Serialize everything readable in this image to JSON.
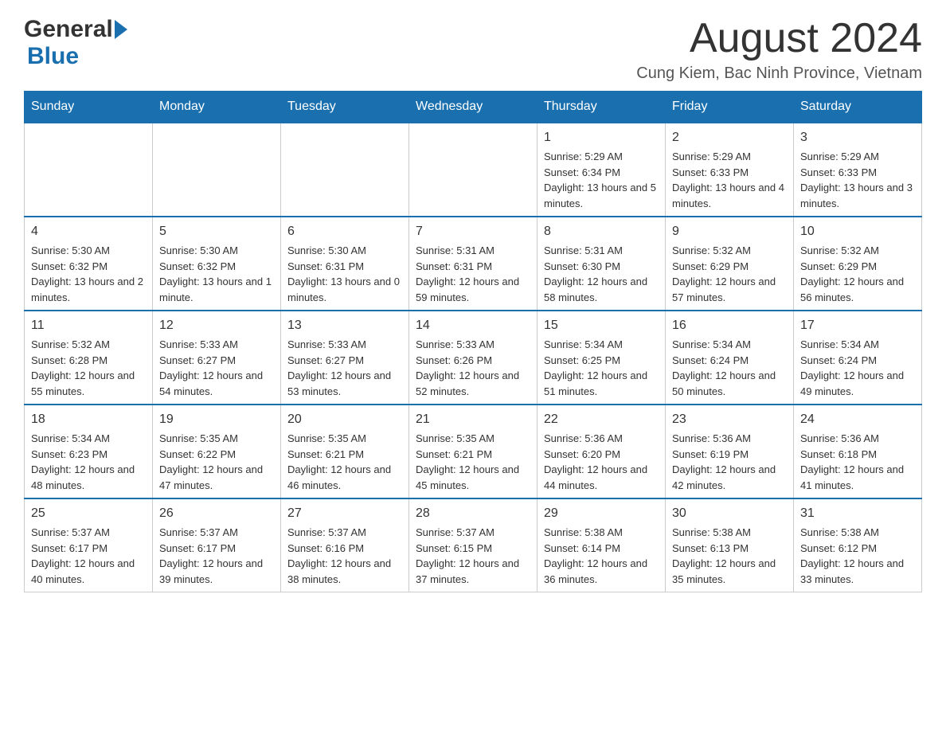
{
  "header": {
    "logo_general": "General",
    "logo_blue": "Blue",
    "month_title": "August 2024",
    "location": "Cung Kiem, Bac Ninh Province, Vietnam"
  },
  "calendar": {
    "days_of_week": [
      "Sunday",
      "Monday",
      "Tuesday",
      "Wednesday",
      "Thursday",
      "Friday",
      "Saturday"
    ],
    "weeks": [
      [
        {
          "day": "",
          "info": ""
        },
        {
          "day": "",
          "info": ""
        },
        {
          "day": "",
          "info": ""
        },
        {
          "day": "",
          "info": ""
        },
        {
          "day": "1",
          "info": "Sunrise: 5:29 AM\nSunset: 6:34 PM\nDaylight: 13 hours and 5 minutes."
        },
        {
          "day": "2",
          "info": "Sunrise: 5:29 AM\nSunset: 6:33 PM\nDaylight: 13 hours and 4 minutes."
        },
        {
          "day": "3",
          "info": "Sunrise: 5:29 AM\nSunset: 6:33 PM\nDaylight: 13 hours and 3 minutes."
        }
      ],
      [
        {
          "day": "4",
          "info": "Sunrise: 5:30 AM\nSunset: 6:32 PM\nDaylight: 13 hours and 2 minutes."
        },
        {
          "day": "5",
          "info": "Sunrise: 5:30 AM\nSunset: 6:32 PM\nDaylight: 13 hours and 1 minute."
        },
        {
          "day": "6",
          "info": "Sunrise: 5:30 AM\nSunset: 6:31 PM\nDaylight: 13 hours and 0 minutes."
        },
        {
          "day": "7",
          "info": "Sunrise: 5:31 AM\nSunset: 6:31 PM\nDaylight: 12 hours and 59 minutes."
        },
        {
          "day": "8",
          "info": "Sunrise: 5:31 AM\nSunset: 6:30 PM\nDaylight: 12 hours and 58 minutes."
        },
        {
          "day": "9",
          "info": "Sunrise: 5:32 AM\nSunset: 6:29 PM\nDaylight: 12 hours and 57 minutes."
        },
        {
          "day": "10",
          "info": "Sunrise: 5:32 AM\nSunset: 6:29 PM\nDaylight: 12 hours and 56 minutes."
        }
      ],
      [
        {
          "day": "11",
          "info": "Sunrise: 5:32 AM\nSunset: 6:28 PM\nDaylight: 12 hours and 55 minutes."
        },
        {
          "day": "12",
          "info": "Sunrise: 5:33 AM\nSunset: 6:27 PM\nDaylight: 12 hours and 54 minutes."
        },
        {
          "day": "13",
          "info": "Sunrise: 5:33 AM\nSunset: 6:27 PM\nDaylight: 12 hours and 53 minutes."
        },
        {
          "day": "14",
          "info": "Sunrise: 5:33 AM\nSunset: 6:26 PM\nDaylight: 12 hours and 52 minutes."
        },
        {
          "day": "15",
          "info": "Sunrise: 5:34 AM\nSunset: 6:25 PM\nDaylight: 12 hours and 51 minutes."
        },
        {
          "day": "16",
          "info": "Sunrise: 5:34 AM\nSunset: 6:24 PM\nDaylight: 12 hours and 50 minutes."
        },
        {
          "day": "17",
          "info": "Sunrise: 5:34 AM\nSunset: 6:24 PM\nDaylight: 12 hours and 49 minutes."
        }
      ],
      [
        {
          "day": "18",
          "info": "Sunrise: 5:34 AM\nSunset: 6:23 PM\nDaylight: 12 hours and 48 minutes."
        },
        {
          "day": "19",
          "info": "Sunrise: 5:35 AM\nSunset: 6:22 PM\nDaylight: 12 hours and 47 minutes."
        },
        {
          "day": "20",
          "info": "Sunrise: 5:35 AM\nSunset: 6:21 PM\nDaylight: 12 hours and 46 minutes."
        },
        {
          "day": "21",
          "info": "Sunrise: 5:35 AM\nSunset: 6:21 PM\nDaylight: 12 hours and 45 minutes."
        },
        {
          "day": "22",
          "info": "Sunrise: 5:36 AM\nSunset: 6:20 PM\nDaylight: 12 hours and 44 minutes."
        },
        {
          "day": "23",
          "info": "Sunrise: 5:36 AM\nSunset: 6:19 PM\nDaylight: 12 hours and 42 minutes."
        },
        {
          "day": "24",
          "info": "Sunrise: 5:36 AM\nSunset: 6:18 PM\nDaylight: 12 hours and 41 minutes."
        }
      ],
      [
        {
          "day": "25",
          "info": "Sunrise: 5:37 AM\nSunset: 6:17 PM\nDaylight: 12 hours and 40 minutes."
        },
        {
          "day": "26",
          "info": "Sunrise: 5:37 AM\nSunset: 6:17 PM\nDaylight: 12 hours and 39 minutes."
        },
        {
          "day": "27",
          "info": "Sunrise: 5:37 AM\nSunset: 6:16 PM\nDaylight: 12 hours and 38 minutes."
        },
        {
          "day": "28",
          "info": "Sunrise: 5:37 AM\nSunset: 6:15 PM\nDaylight: 12 hours and 37 minutes."
        },
        {
          "day": "29",
          "info": "Sunrise: 5:38 AM\nSunset: 6:14 PM\nDaylight: 12 hours and 36 minutes."
        },
        {
          "day": "30",
          "info": "Sunrise: 5:38 AM\nSunset: 6:13 PM\nDaylight: 12 hours and 35 minutes."
        },
        {
          "day": "31",
          "info": "Sunrise: 5:38 AM\nSunset: 6:12 PM\nDaylight: 12 hours and 33 minutes."
        }
      ]
    ]
  }
}
